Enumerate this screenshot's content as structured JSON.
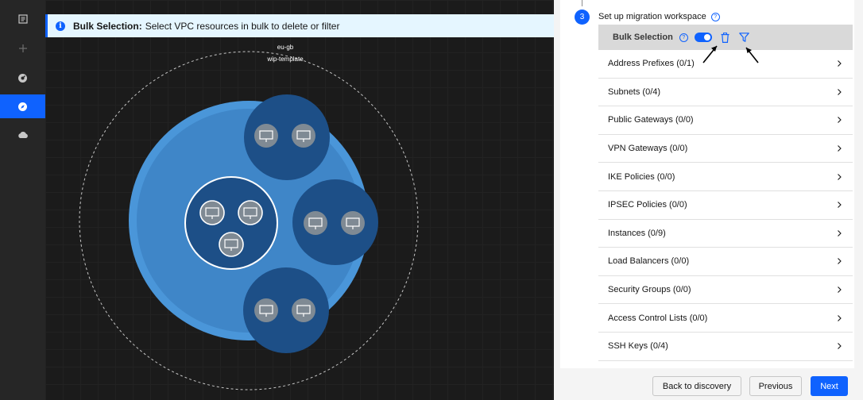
{
  "rail": {
    "items": [
      {
        "name": "list-icon"
      },
      {
        "name": "add-icon"
      },
      {
        "name": "dashboard-icon"
      },
      {
        "name": "compass-icon"
      },
      {
        "name": "cloud-icon"
      }
    ],
    "active_index": 3
  },
  "banner": {
    "title": "Bulk Selection:",
    "message": "Select VPC resources in bulk to delete or filter"
  },
  "diagram": {
    "region_label": "eu-gb",
    "vpc_label": "wip-template",
    "subnets": [
      {
        "instances": 2
      },
      {
        "instances": 3,
        "selected": true
      },
      {
        "instances": 2
      },
      {
        "instances": 2
      }
    ]
  },
  "step": {
    "number": "3",
    "title": "Set up migration workspace"
  },
  "bulk": {
    "label": "Bulk Selection",
    "enabled": true
  },
  "resources": [
    {
      "label": "Address Prefixes  (0/1)"
    },
    {
      "label": "Subnets  (0/4)"
    },
    {
      "label": "Public Gateways  (0/0)"
    },
    {
      "label": "VPN Gateways  (0/0)"
    },
    {
      "label": "IKE Policies  (0/0)"
    },
    {
      "label": "IPSEC Policies  (0/0)"
    },
    {
      "label": "Instances  (0/9)"
    },
    {
      "label": "Load Balancers  (0/0)"
    },
    {
      "label": "Security Groups  (0/0)"
    },
    {
      "label": "Access Control Lists  (0/0)"
    },
    {
      "label": "SSH Keys  (0/4)"
    }
  ],
  "footer": {
    "back_label": "Back to discovery",
    "previous_label": "Previous",
    "next_label": "Next"
  },
  "colors": {
    "accent": "#0f62fe",
    "vpc_outer": "#4a96d9",
    "vpc_inner": "#3f86c8",
    "subnet": "#1d4f87"
  }
}
